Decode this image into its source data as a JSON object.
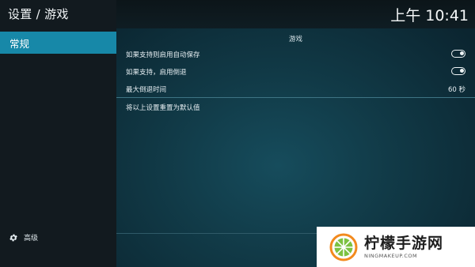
{
  "header": {
    "title": "设置 / 游戏",
    "clock": "上午 10:41"
  },
  "sidebar": {
    "items": [
      {
        "label": "常规",
        "selected": true
      }
    ],
    "advanced_label": "高级"
  },
  "section": {
    "title": "游戏"
  },
  "settings": [
    {
      "label": "如果支持则启用自动保存",
      "type": "toggle",
      "value": "on"
    },
    {
      "label": "如果支持，启用倒退",
      "type": "toggle",
      "value": "on"
    },
    {
      "label": "最大倒退时间",
      "type": "value",
      "value": "60 秒"
    },
    {
      "label": "将以上设置重置为默认值",
      "type": "action"
    }
  ],
  "watermark": {
    "name": "柠檬手游网",
    "url": "NINGMAKEUP.COM"
  },
  "colors": {
    "accent": "#1788a8",
    "sidebar_bg": "#121a1f",
    "main_bg": "#164c5c",
    "logo_orange": "#f28a1e",
    "logo_green": "#7cc242"
  }
}
